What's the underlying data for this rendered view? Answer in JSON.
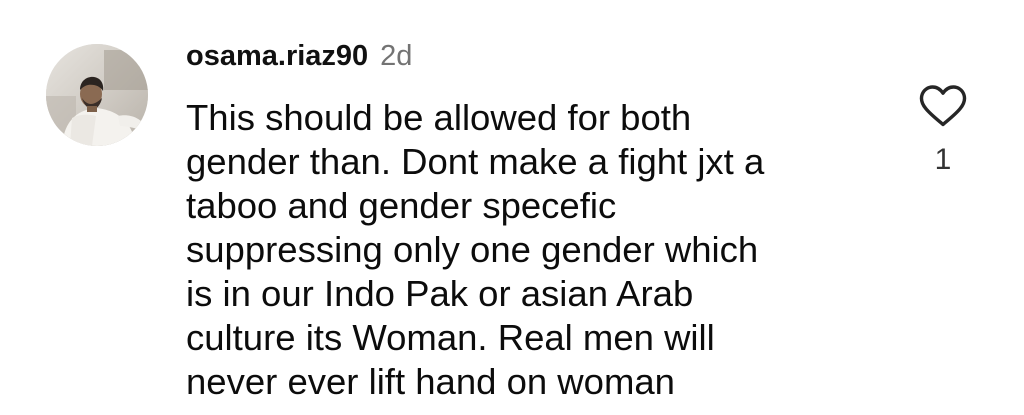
{
  "comment": {
    "username": "osama.riaz90",
    "timestamp": "2d",
    "text_lines": [
      "This should be allowed for both",
      "gender than. Dont make a fight jxt a",
      "taboo and gender specefic",
      "suppressing only one gender which",
      "is in our Indo Pak or asian Arab",
      "culture its Woman. Real men will",
      "never ever lift hand on woman"
    ],
    "like_count": "1",
    "like_icon": "heart-outline-icon"
  },
  "colors": {
    "text": "#0c0c0c",
    "timestamp": "#737373",
    "background": "#ffffff"
  }
}
